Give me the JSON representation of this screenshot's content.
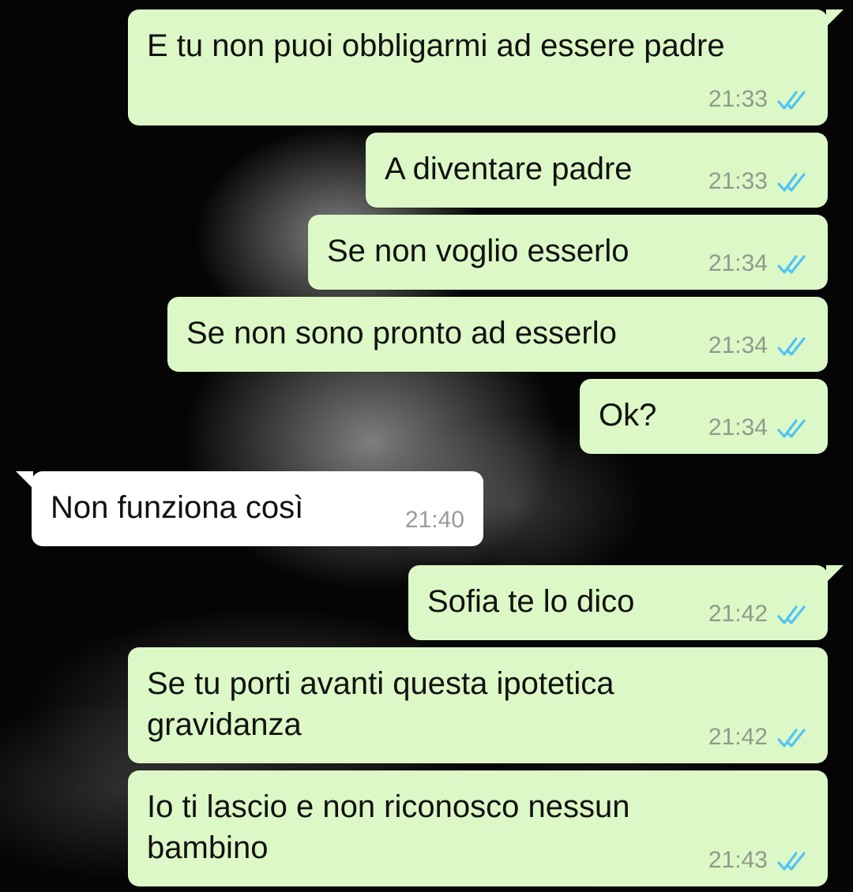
{
  "messages": [
    {
      "text": "E tu non puoi obbligarmi ad essere padre",
      "time": "21:33",
      "status_icon": "double-check-read-icon",
      "direction": "outgoing"
    },
    {
      "text": "A diventare padre",
      "time": "21:33",
      "status_icon": "double-check-read-icon",
      "direction": "outgoing"
    },
    {
      "text": "Se non voglio esserlo",
      "time": "21:34",
      "status_icon": "double-check-read-icon",
      "direction": "outgoing"
    },
    {
      "text": "Se non sono pronto ad esserlo",
      "time": "21:34",
      "status_icon": "double-check-read-icon",
      "direction": "outgoing"
    },
    {
      "text": "Ok?",
      "time": "21:34",
      "status_icon": "double-check-read-icon",
      "direction": "outgoing"
    },
    {
      "text": "Non funziona così",
      "time": "21:40",
      "direction": "incoming"
    },
    {
      "text": "Sofia te lo dico",
      "time": "21:42",
      "status_icon": "double-check-read-icon",
      "direction": "outgoing"
    },
    {
      "text": "Se tu porti avanti questa ipotetica\ngravidanza",
      "time": "21:42",
      "status_icon": "double-check-read-icon",
      "direction": "outgoing"
    },
    {
      "text": "Io ti lascio e non riconosco nessun\nbambino",
      "time": "21:43",
      "status_icon": "double-check-read-icon",
      "direction": "outgoing"
    }
  ],
  "colors": {
    "outgoing_bubble": "#dcf8c6",
    "incoming_bubble": "#ffffff",
    "read_ticks": "#4fc3f7",
    "timestamp": "#8f9a8c",
    "background": "#050505"
  }
}
